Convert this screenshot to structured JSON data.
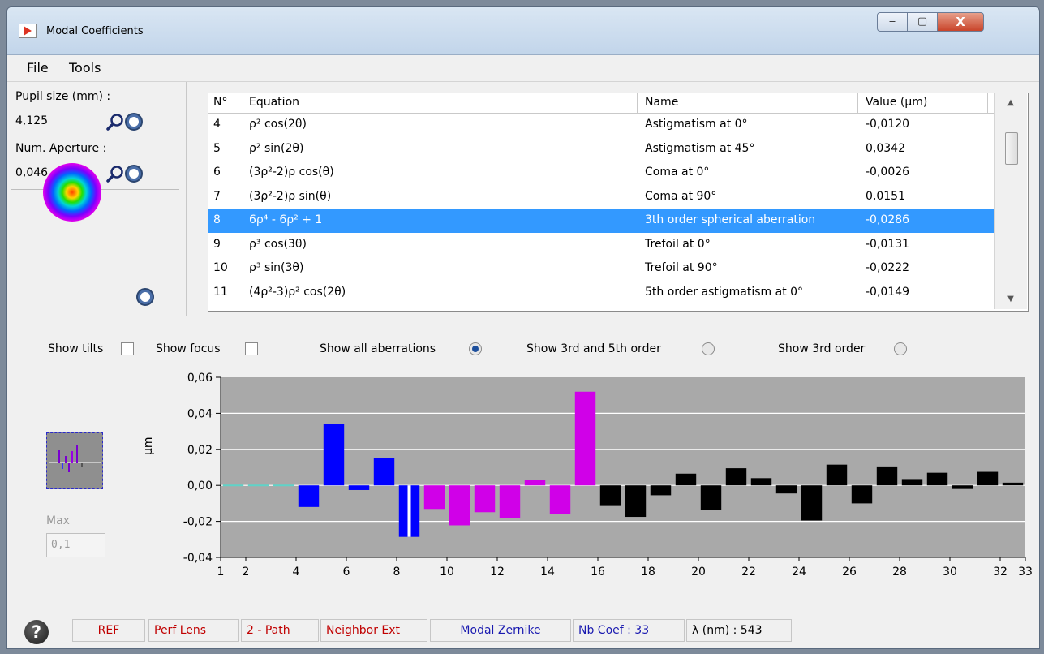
{
  "window": {
    "title": "Modal Coefficients",
    "minimize": "‒",
    "maximize": "▢",
    "close": "X"
  },
  "menu": {
    "file": "File",
    "tools": "Tools"
  },
  "left": {
    "pupil_label": "Pupil size (mm) :",
    "pupil_value": "4,125",
    "na_label": "Num. Aperture :",
    "na_value": "0,046"
  },
  "table": {
    "headers": {
      "num": "N°",
      "equation": "Equation",
      "name": "Name",
      "value": "Value (µm)"
    },
    "rows": [
      {
        "num": "4",
        "eq": "ρ² cos(2θ)",
        "name": "Astigmatism at 0°",
        "value": "-0,0120"
      },
      {
        "num": "5",
        "eq": "ρ² sin(2θ)",
        "name": "Astigmatism at 45°",
        "value": "0,0342"
      },
      {
        "num": "6",
        "eq": "(3ρ²-2)ρ cos(θ)",
        "name": "Coma at 0°",
        "value": "-0,0026"
      },
      {
        "num": "7",
        "eq": "(3ρ²-2)ρ sin(θ)",
        "name": "Coma at 90°",
        "value": "0,0151"
      },
      {
        "num": "8",
        "eq": "6ρ⁴ - 6ρ² + 1",
        "name": "3th order spherical aberration",
        "value": "-0,0286"
      },
      {
        "num": "9",
        "eq": "ρ³ cos(3θ)",
        "name": "Trefoil at 0°",
        "value": "-0,0131"
      },
      {
        "num": "10",
        "eq": "ρ³ sin(3θ)",
        "name": "Trefoil at 90°",
        "value": "-0,0222"
      },
      {
        "num": "11",
        "eq": "(4ρ²-3)ρ² cos(2θ)",
        "name": "5th order astigmatism at 0°",
        "value": "-0,0149"
      }
    ],
    "selected_num": "8"
  },
  "options": {
    "show_tilts": "Show tilts",
    "show_focus": "Show focus",
    "show_all": "Show all aberrations",
    "show_35": "Show 3rd and 5th order",
    "show_3": "Show 3rd order",
    "selected": "show_all"
  },
  "max": {
    "label": "Max",
    "value": "0,1"
  },
  "chart_data": {
    "type": "bar",
    "ylabel": "µm",
    "ylim": [
      -0.04,
      0.06
    ],
    "yticks": [
      "0,06",
      "0,04",
      "0,02",
      "0,00",
      "-0,02",
      "-0,04"
    ],
    "xticks": [
      "1",
      "2",
      "4",
      "6",
      "8",
      "10",
      "12",
      "14",
      "16",
      "18",
      "20",
      "22",
      "24",
      "26",
      "28",
      "30",
      "32",
      "33"
    ],
    "x": [
      1,
      2,
      3,
      4,
      5,
      6,
      7,
      8,
      9,
      10,
      11,
      12,
      13,
      14,
      15,
      16,
      17,
      18,
      19,
      20,
      21,
      22,
      23,
      24,
      25,
      26,
      27,
      28,
      29,
      30,
      31,
      32
    ],
    "values": [
      0.0,
      0.0,
      0.0,
      -0.012,
      0.0342,
      -0.0026,
      0.0151,
      -0.0286,
      -0.0131,
      -0.0222,
      -0.0149,
      -0.018,
      0.003,
      -0.016,
      0.052,
      -0.011,
      -0.0175,
      -0.0055,
      0.0065,
      -0.0135,
      0.0095,
      0.004,
      -0.0045,
      -0.0195,
      0.0115,
      -0.01,
      0.0105,
      0.0035,
      0.007,
      -0.002,
      0.0075,
      0.0015
    ],
    "colors": {
      "tilt": "#5fd3c8",
      "third": "#0000ff",
      "fifth": "#d000e8",
      "higher": "#000000",
      "background": "#a9a9a9",
      "grid": "#ffffff"
    }
  },
  "status": {
    "ref": "REF",
    "perf": "Perf Lens",
    "path": "2 - Path",
    "neighbor": "Neighbor Ext",
    "modal": "Modal Zernike",
    "nbcoef": "Nb Coef : 33",
    "lambda": "λ (nm) : 543"
  }
}
